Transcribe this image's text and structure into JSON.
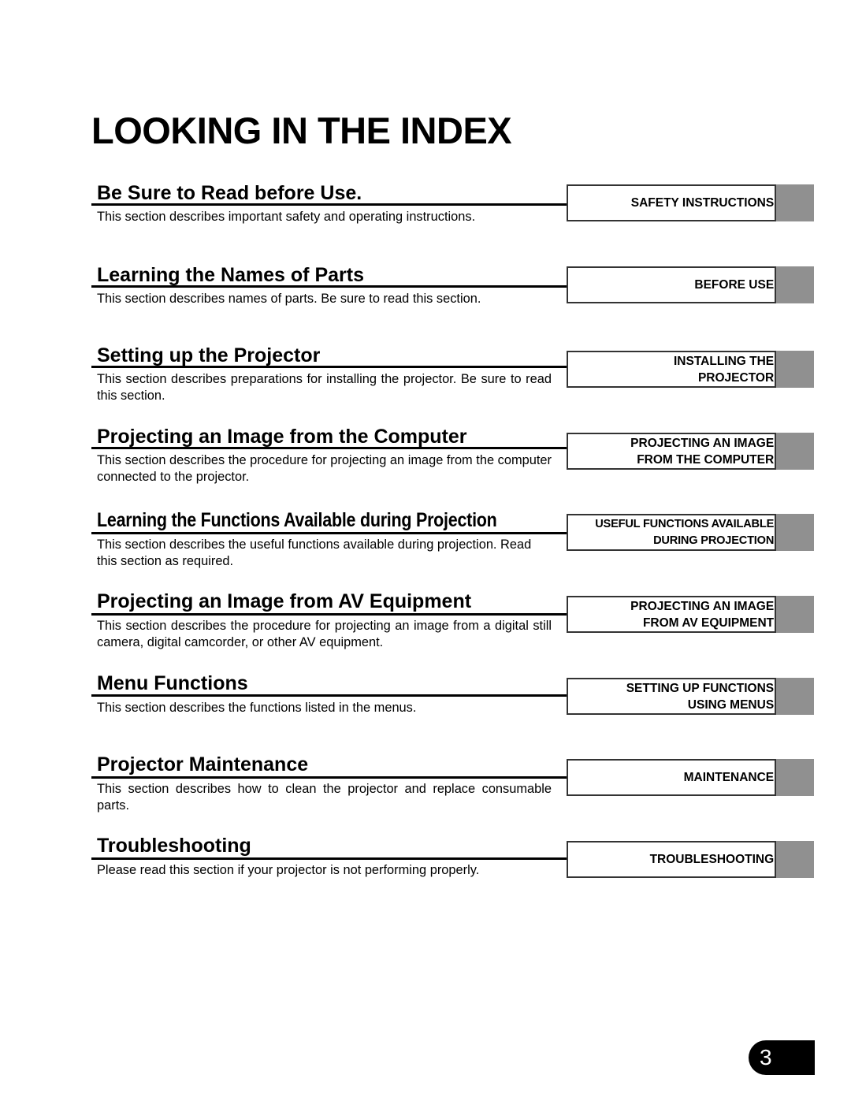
{
  "page": {
    "title": "LOOKING IN THE INDEX",
    "page_number": "3"
  },
  "colors": {
    "tab_gray": "#909090",
    "text": "#000000",
    "badge": "#000000"
  },
  "sections": [
    {
      "heading": "Be Sure to Read before Use.",
      "description": "This section describes important safety and operating instructions.",
      "tab_lines": [
        "SAFETY INSTRUCTIONS"
      ]
    },
    {
      "heading": "Learning the Names of Parts",
      "description": "This section describes names of parts. Be sure to read this section.",
      "tab_lines": [
        "BEFORE USE"
      ]
    },
    {
      "heading": "Setting up the Projector",
      "description": "This section describes preparations for installing the projector. Be sure to read this section.",
      "tab_lines": [
        "INSTALLING THE",
        "PROJECTOR"
      ]
    },
    {
      "heading": "Projecting an Image from the Computer",
      "description": "This section describes the procedure for projecting an image from the computer connected to the projector.",
      "tab_lines": [
        "PROJECTING AN IMAGE",
        "FROM THE COMPUTER"
      ]
    },
    {
      "heading": "Learning the Functions Available during Projection",
      "description": "This section describes the useful functions available during projection. Read this section as required.",
      "tab_lines": [
        "USEFUL FUNCTIONS AVAILABLE",
        "DURING PROJECTION"
      ]
    },
    {
      "heading": "Projecting an Image from AV Equipment",
      "description": "This section describes the procedure for projecting an image from a digital still camera, digital camcorder, or other AV equipment.",
      "tab_lines": [
        "PROJECTING AN IMAGE",
        "FROM AV EQUIPMENT"
      ]
    },
    {
      "heading": "Menu Functions",
      "description": "This section describes the functions listed in the menus.",
      "tab_lines": [
        "SETTING UP FUNCTIONS",
        "USING MENUS"
      ]
    },
    {
      "heading": "Projector Maintenance",
      "description": "This section describes how to clean the projector and replace consumable parts.",
      "tab_lines": [
        "MAINTENANCE"
      ]
    },
    {
      "heading": "Troubleshooting",
      "description": "Please read this section if your projector is not performing properly.",
      "tab_lines": [
        "TROUBLESHOOTING"
      ]
    }
  ]
}
